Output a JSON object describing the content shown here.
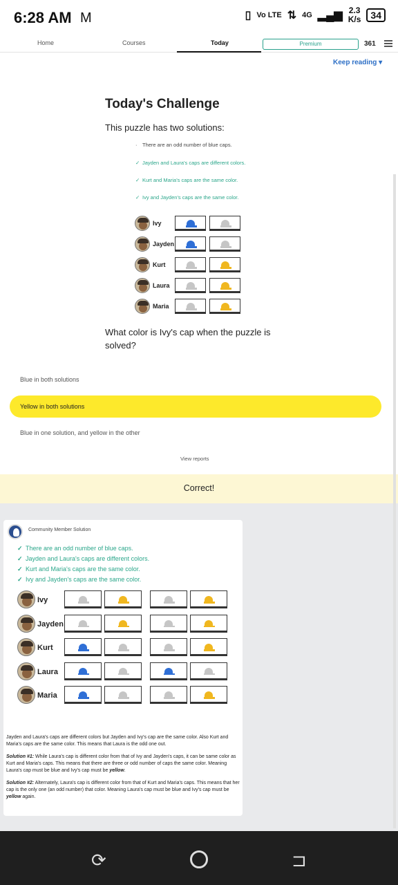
{
  "status_bar": {
    "time": "6:28 AM",
    "mail_icon": "gmail-m-icon",
    "vo_lte": "Vo LTE",
    "net": "4G",
    "speed_value": "2.3",
    "speed_unit": "K/s",
    "battery": "34"
  },
  "nav": {
    "tabs": [
      "Home",
      "Courses",
      "Today"
    ],
    "active_tab": "Today",
    "premium": "Premium",
    "streak": "361"
  },
  "keep_reading": "Keep reading ▾",
  "challenge": {
    "title": "Today's Challenge",
    "intro": "This puzzle has two solutions:",
    "clues": [
      {
        "mark": "·",
        "text": "There are an odd number of blue caps.",
        "style": "grey"
      },
      {
        "mark": "✓",
        "text": "Jayden and Laura's caps are different colors.",
        "style": "green"
      },
      {
        "mark": "✓",
        "text": "Kurt and Maria's caps are the same color.",
        "style": "green"
      },
      {
        "mark": "✓",
        "text": "Ivy and Jayden's caps are the same color.",
        "style": "green"
      }
    ],
    "people": [
      {
        "name": "Ivy",
        "caps": [
          "blue",
          "grey"
        ]
      },
      {
        "name": "Jayden",
        "caps": [
          "blue",
          "grey"
        ]
      },
      {
        "name": "Kurt",
        "caps": [
          "grey",
          "yellow"
        ]
      },
      {
        "name": "Laura",
        "caps": [
          "grey",
          "yellow"
        ]
      },
      {
        "name": "Maria",
        "caps": [
          "grey",
          "yellow"
        ]
      }
    ],
    "question": "What color is Ivy's cap when the puzzle is solved?",
    "options": [
      "Blue in both solutions",
      "Yellow in both solutions",
      "Blue in one solution, and yellow in the other"
    ],
    "selected_option": 1,
    "view_reports": "View reports",
    "result": "Correct!"
  },
  "community": {
    "by": "Community Member Solution",
    "clues": [
      "There are an odd number of blue caps.",
      "Jayden and Laura's caps are different colors.",
      "Kurt and Maria's caps are the same color.",
      "Ivy and Jayden's caps are the same color."
    ],
    "people": [
      {
        "name": "Ivy",
        "caps": [
          "grey",
          "yellow",
          "grey",
          "yellow"
        ]
      },
      {
        "name": "Jayden",
        "caps": [
          "grey",
          "yellow",
          "grey",
          "yellow"
        ]
      },
      {
        "name": "Kurt",
        "caps": [
          "blue",
          "grey",
          "grey",
          "yellow"
        ]
      },
      {
        "name": "Laura",
        "caps": [
          "blue",
          "grey",
          "blue",
          "grey"
        ]
      },
      {
        "name": "Maria",
        "caps": [
          "blue",
          "grey",
          "grey",
          "yellow"
        ]
      }
    ],
    "explanation": {
      "p1": "Jayden and Laura's caps are different colors but Jayden and Ivy's cap are the same color. Also Kurt and Maria's caps are the same color. This means that Laura is the odd one out.",
      "s1_label": "Solution #1:",
      "s1_text": " While Laura's cap is different color from that of Ivy and Jayden's caps, it can be same color as Kurt and Maria's caps. This means that there are three or odd number of caps the same color. Meaning Laura's cap must be blue and Ivy's cap must be ",
      "s1_end": "yellow",
      "s2_label": "Solution #2:",
      "s2_text": " Alternately, Laura's cap is different color from that of Kurt and Maria's caps. This means that her cap is the only one (an odd number) that color. Meaning Laura's cap must be blue and Ivy's cap must be ",
      "s2_end": "yellow",
      "s2_tail": " again."
    }
  },
  "colors": {
    "blue": "#2f6fd6",
    "yellow": "#f0b71f",
    "grey": "#c6c6c6",
    "green": "#2aa68a",
    "accent_yellow": "#fde92b"
  }
}
